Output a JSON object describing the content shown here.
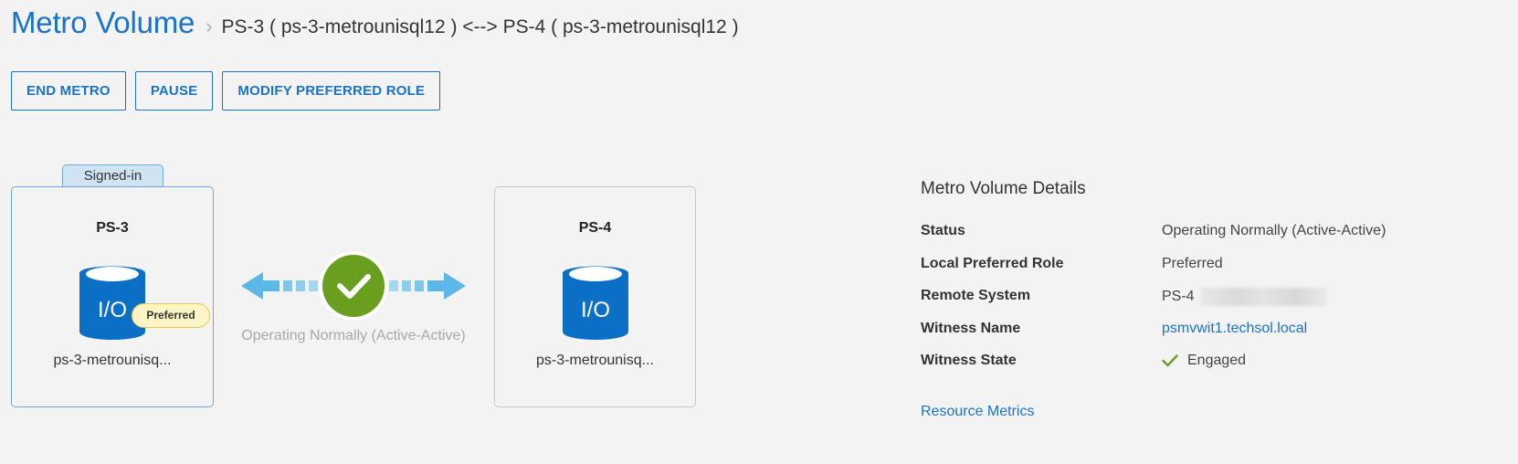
{
  "header": {
    "title": "Metro Volume",
    "separator_icon": "chevron-right-icon",
    "breadcrumb": "PS-3 ( ps-3-metrounisql12 ) <--> PS-4 ( ps-3-metrounisql12 )"
  },
  "toolbar": {
    "end_metro_label": "END METRO",
    "pause_label": "PAUSE",
    "modify_role_label": "MODIFY PREFERRED ROLE"
  },
  "topology": {
    "local": {
      "tab_label": "Signed-in",
      "system_name": "PS-3",
      "icon": "database-io-icon",
      "icon_text": "I/O",
      "badge": "Preferred",
      "volume_name": "ps-3-metrounisq..."
    },
    "link": {
      "icon": "check-circle-icon",
      "status": "Operating Normally (Active-Active)"
    },
    "remote": {
      "system_name": "PS-4",
      "icon": "database-io-icon",
      "icon_text": "I/O",
      "volume_name": "ps-3-metrounisq..."
    }
  },
  "details": {
    "title": "Metro Volume Details",
    "rows": [
      {
        "label": "Status",
        "value": "Operating Normally (Active-Active)"
      },
      {
        "label": "Local Preferred Role",
        "value": "Preferred"
      },
      {
        "label": "Remote System",
        "value": "PS-4"
      },
      {
        "label": "Witness Name",
        "value": "psmvwit1.techsol.local"
      },
      {
        "label": "Witness State",
        "value": "Engaged",
        "icon": "check-icon"
      }
    ],
    "resource_metrics_link": "Resource Metrics"
  },
  "colors": {
    "accent": "#1a73c8",
    "db_blue": "#0b6fc6",
    "arrow_blue": "#5bb8e8",
    "status_green": "#6a9e1f",
    "badge_fill": "#fdf5c4",
    "badge_border": "#e8c64a"
  }
}
